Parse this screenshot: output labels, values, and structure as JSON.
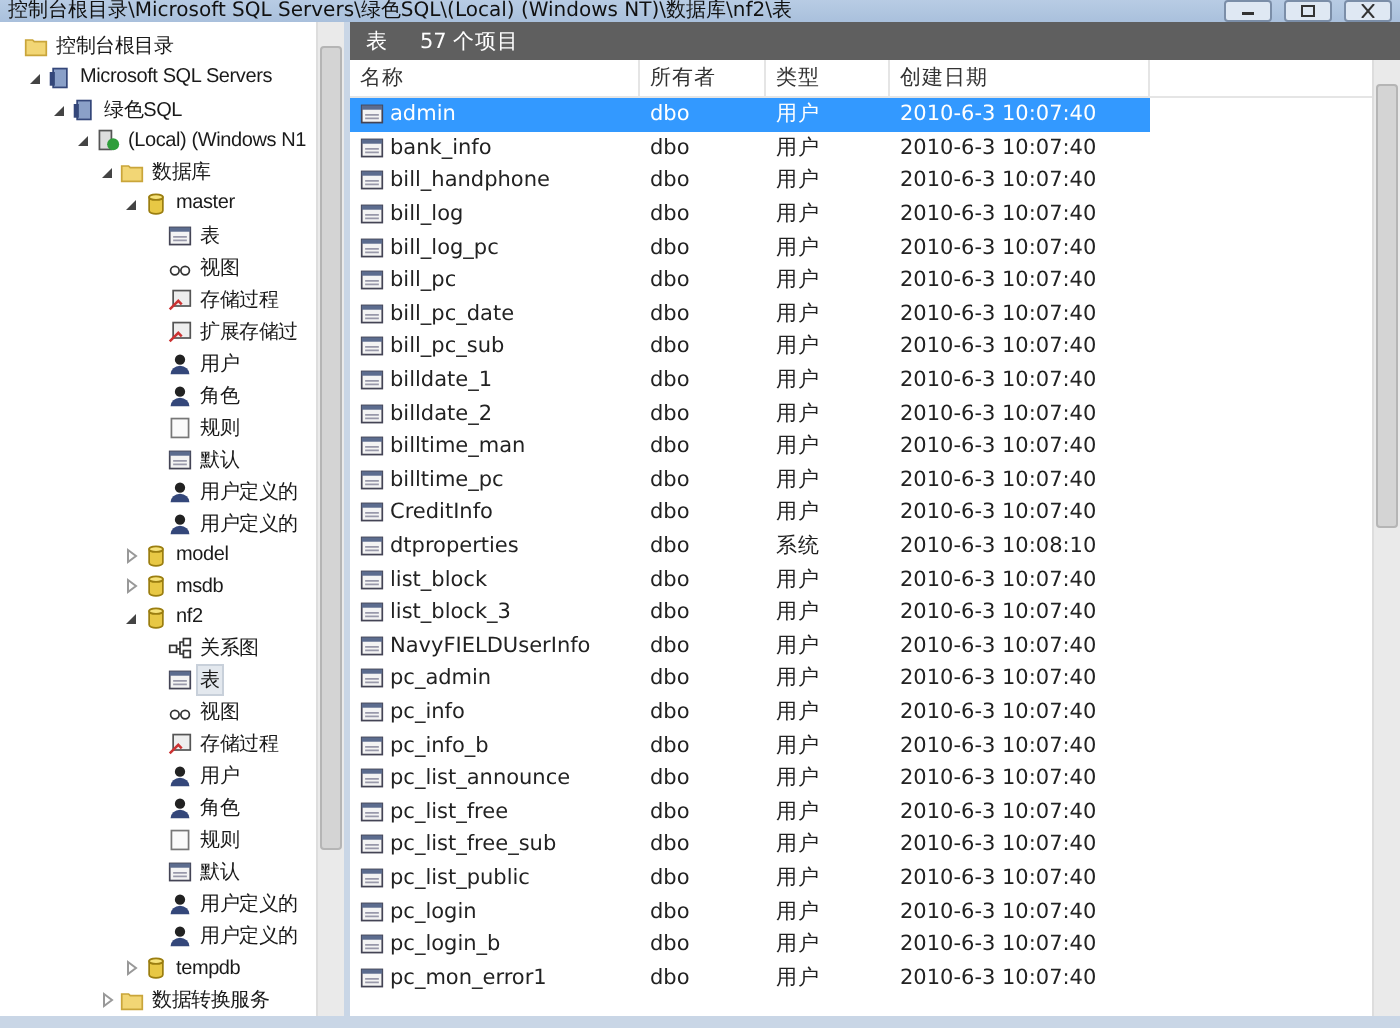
{
  "window": {
    "title": "控制台根目录\\Microsoft SQL Servers\\绿色SQL\\(Local) (Windows NT)\\数据库\\nf2\\表"
  },
  "tree": [
    {
      "label": "控制台根目录",
      "kind": "folder",
      "selected": false,
      "children": [
        {
          "label": "Microsoft SQL Servers",
          "kind": "group",
          "expanded": true,
          "selected": false,
          "children": [
            {
              "label": "绿色SQL",
              "kind": "group",
              "expanded": true,
              "selected": false,
              "children": [
                {
                  "label": "(Local) (Windows N1",
                  "kind": "server",
                  "expanded": true,
                  "selected": false,
                  "children": [
                    {
                      "label": "数据库",
                      "kind": "folder",
                      "expanded": true,
                      "selected": false,
                      "children": [
                        {
                          "label": "master",
                          "kind": "database",
                          "expanded": true,
                          "selected": false,
                          "children": [
                            {
                              "label": "表",
                              "kind": "table",
                              "selected": false
                            },
                            {
                              "label": "视图",
                              "kind": "view",
                              "selected": false
                            },
                            {
                              "label": "存储过程",
                              "kind": "procedure",
                              "selected": false
                            },
                            {
                              "label": "扩展存储过",
                              "kind": "procedure",
                              "selected": false
                            },
                            {
                              "label": "用户",
                              "kind": "user",
                              "selected": false
                            },
                            {
                              "label": "角色",
                              "kind": "role",
                              "selected": false
                            },
                            {
                              "label": "规则",
                              "kind": "rule",
                              "selected": false
                            },
                            {
                              "label": "默认",
                              "kind": "table",
                              "selected": false
                            },
                            {
                              "label": "用户定义的",
                              "kind": "udt",
                              "selected": false
                            },
                            {
                              "label": "用户定义的",
                              "kind": "udt",
                              "selected": false
                            }
                          ]
                        },
                        {
                          "label": "model",
                          "kind": "database",
                          "expanded": false,
                          "selected": false
                        },
                        {
                          "label": "msdb",
                          "kind": "database",
                          "expanded": false,
                          "selected": false
                        },
                        {
                          "label": "nf2",
                          "kind": "database",
                          "expanded": true,
                          "selected": false,
                          "children": [
                            {
                              "label": "关系图",
                              "kind": "diagram",
                              "selected": false
                            },
                            {
                              "label": "表",
                              "kind": "table",
                              "selected": true
                            },
                            {
                              "label": "视图",
                              "kind": "view",
                              "selected": false
                            },
                            {
                              "label": "存储过程",
                              "kind": "procedure",
                              "selected": false
                            },
                            {
                              "label": "用户",
                              "kind": "user",
                              "selected": false
                            },
                            {
                              "label": "角色",
                              "kind": "role",
                              "selected": false
                            },
                            {
                              "label": "规则",
                              "kind": "rule",
                              "selected": false
                            },
                            {
                              "label": "默认",
                              "kind": "table",
                              "selected": false
                            },
                            {
                              "label": "用户定义的",
                              "kind": "udt",
                              "selected": false
                            },
                            {
                              "label": "用户定义的",
                              "kind": "udt",
                              "selected": false
                            }
                          ]
                        },
                        {
                          "label": "tempdb",
                          "kind": "database",
                          "expanded": false,
                          "selected": false
                        }
                      ]
                    },
                    {
                      "label": "数据转换服务",
                      "kind": "folder",
                      "expanded": false,
                      "selected": false
                    }
                  ]
                }
              ]
            }
          ]
        }
      ]
    }
  ],
  "header": {
    "title": "表",
    "count": "57 个项目"
  },
  "columns": [
    "名称",
    "所有者",
    "类型",
    "创建日期"
  ],
  "rows": [
    {
      "name": "admin",
      "owner": "dbo",
      "type": "用户",
      "created": "2010-6-3 10:07:40",
      "selected": true
    },
    {
      "name": "bank_info",
      "owner": "dbo",
      "type": "用户",
      "created": "2010-6-3 10:07:40",
      "selected": false
    },
    {
      "name": "bill_handphone",
      "owner": "dbo",
      "type": "用户",
      "created": "2010-6-3 10:07:40",
      "selected": false
    },
    {
      "name": "bill_log",
      "owner": "dbo",
      "type": "用户",
      "created": "2010-6-3 10:07:40",
      "selected": false
    },
    {
      "name": "bill_log_pc",
      "owner": "dbo",
      "type": "用户",
      "created": "2010-6-3 10:07:40",
      "selected": false
    },
    {
      "name": "bill_pc",
      "owner": "dbo",
      "type": "用户",
      "created": "2010-6-3 10:07:40",
      "selected": false
    },
    {
      "name": "bill_pc_date",
      "owner": "dbo",
      "type": "用户",
      "created": "2010-6-3 10:07:40",
      "selected": false
    },
    {
      "name": "bill_pc_sub",
      "owner": "dbo",
      "type": "用户",
      "created": "2010-6-3 10:07:40",
      "selected": false
    },
    {
      "name": "billdate_1",
      "owner": "dbo",
      "type": "用户",
      "created": "2010-6-3 10:07:40",
      "selected": false
    },
    {
      "name": "billdate_2",
      "owner": "dbo",
      "type": "用户",
      "created": "2010-6-3 10:07:40",
      "selected": false
    },
    {
      "name": "billtime_man",
      "owner": "dbo",
      "type": "用户",
      "created": "2010-6-3 10:07:40",
      "selected": false
    },
    {
      "name": "billtime_pc",
      "owner": "dbo",
      "type": "用户",
      "created": "2010-6-3 10:07:40",
      "selected": false
    },
    {
      "name": "CreditInfo",
      "owner": "dbo",
      "type": "用户",
      "created": "2010-6-3 10:07:40",
      "selected": false
    },
    {
      "name": "dtproperties",
      "owner": "dbo",
      "type": "系统",
      "created": "2010-6-3 10:08:10",
      "selected": false
    },
    {
      "name": "list_block",
      "owner": "dbo",
      "type": "用户",
      "created": "2010-6-3 10:07:40",
      "selected": false
    },
    {
      "name": "list_block_3",
      "owner": "dbo",
      "type": "用户",
      "created": "2010-6-3 10:07:40",
      "selected": false
    },
    {
      "name": "NavyFIELDUserInfo",
      "owner": "dbo",
      "type": "用户",
      "created": "2010-6-3 10:07:40",
      "selected": false
    },
    {
      "name": "pc_admin",
      "owner": "dbo",
      "type": "用户",
      "created": "2010-6-3 10:07:40",
      "selected": false
    },
    {
      "name": "pc_info",
      "owner": "dbo",
      "type": "用户",
      "created": "2010-6-3 10:07:40",
      "selected": false
    },
    {
      "name": "pc_info_b",
      "owner": "dbo",
      "type": "用户",
      "created": "2010-6-3 10:07:40",
      "selected": false
    },
    {
      "name": "pc_list_announce",
      "owner": "dbo",
      "type": "用户",
      "created": "2010-6-3 10:07:40",
      "selected": false
    },
    {
      "name": "pc_list_free",
      "owner": "dbo",
      "type": "用户",
      "created": "2010-6-3 10:07:40",
      "selected": false
    },
    {
      "name": "pc_list_free_sub",
      "owner": "dbo",
      "type": "用户",
      "created": "2010-6-3 10:07:40",
      "selected": false
    },
    {
      "name": "pc_list_public",
      "owner": "dbo",
      "type": "用户",
      "created": "2010-6-3 10:07:40",
      "selected": false
    },
    {
      "name": "pc_login",
      "owner": "dbo",
      "type": "用户",
      "created": "2010-6-3 10:07:40",
      "selected": false
    },
    {
      "name": "pc_login_b",
      "owner": "dbo",
      "type": "用户",
      "created": "2010-6-3 10:07:40",
      "selected": false
    },
    {
      "name": "pc_mon_error1",
      "owner": "dbo",
      "type": "用户",
      "created": "2010-6-3 10:07:40",
      "selected": false
    }
  ]
}
